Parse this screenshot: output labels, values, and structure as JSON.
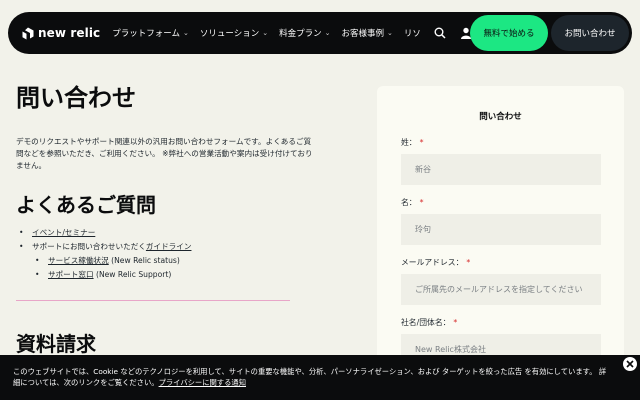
{
  "nav": {
    "logo_text": "new relic",
    "items": [
      {
        "label": "プラットフォーム"
      },
      {
        "label": "ソリューション"
      },
      {
        "label": "料金プラン"
      },
      {
        "label": "お客様事例"
      },
      {
        "label": "リソ"
      }
    ],
    "chevron": "⌄",
    "free_button": "無料で始める",
    "contact_button": "お問い合わせ",
    "icons": [
      "search-icon",
      "user-icon"
    ]
  },
  "main": {
    "title": "問い合わせ",
    "intro": "デモのリクエストやサポート関連以外の汎用お問い合わせフォームです。よくあるご質問などを参照いただき、ご利用ください。 ※弊社への営業活動や案内は受け付けておりません。",
    "faq_title": "よくあるご質問",
    "faq": {
      "item1": "イベント/セミナー",
      "item2_prefix": "サポートにお問い合わせいただく",
      "item2_link": "ガイドライン",
      "sub1_link": "サービス稼働状況",
      "sub1_suffix": " (New Relic status)",
      "sub2_link": "サポート窓口",
      "sub2_suffix": " (New Relic Support)"
    },
    "docs_title": "資料請求"
  },
  "form": {
    "title": "問い合わせ",
    "required_mark": "*",
    "fields": [
      {
        "label": "姓：",
        "placeholder": "新谷"
      },
      {
        "label": "名：",
        "placeholder": "玲句"
      },
      {
        "label": "メールアドレス：",
        "placeholder": "ご所属先のメールアドレスを指定してください"
      },
      {
        "label": "社名/団体名：",
        "placeholder": "New Relic株式会社"
      }
    ]
  },
  "cookie": {
    "text": "このウェブサイトでは、Cookie などのテクノロジーを利用して、サイトの重要な機能や、分析、パーソナライゼーション、および ターゲットを絞った広告 を有効にしています。 詳細については、次のリンクをご覧ください。",
    "link": "プライバシーに関する通知",
    "close": "✕"
  },
  "colors": {
    "nav_bg": "#0b0c0d",
    "accent_green": "#1ce783",
    "page_bg": "#f2f2ea",
    "divider_pink": "#e8a6c8",
    "required_red": "#d62929"
  }
}
